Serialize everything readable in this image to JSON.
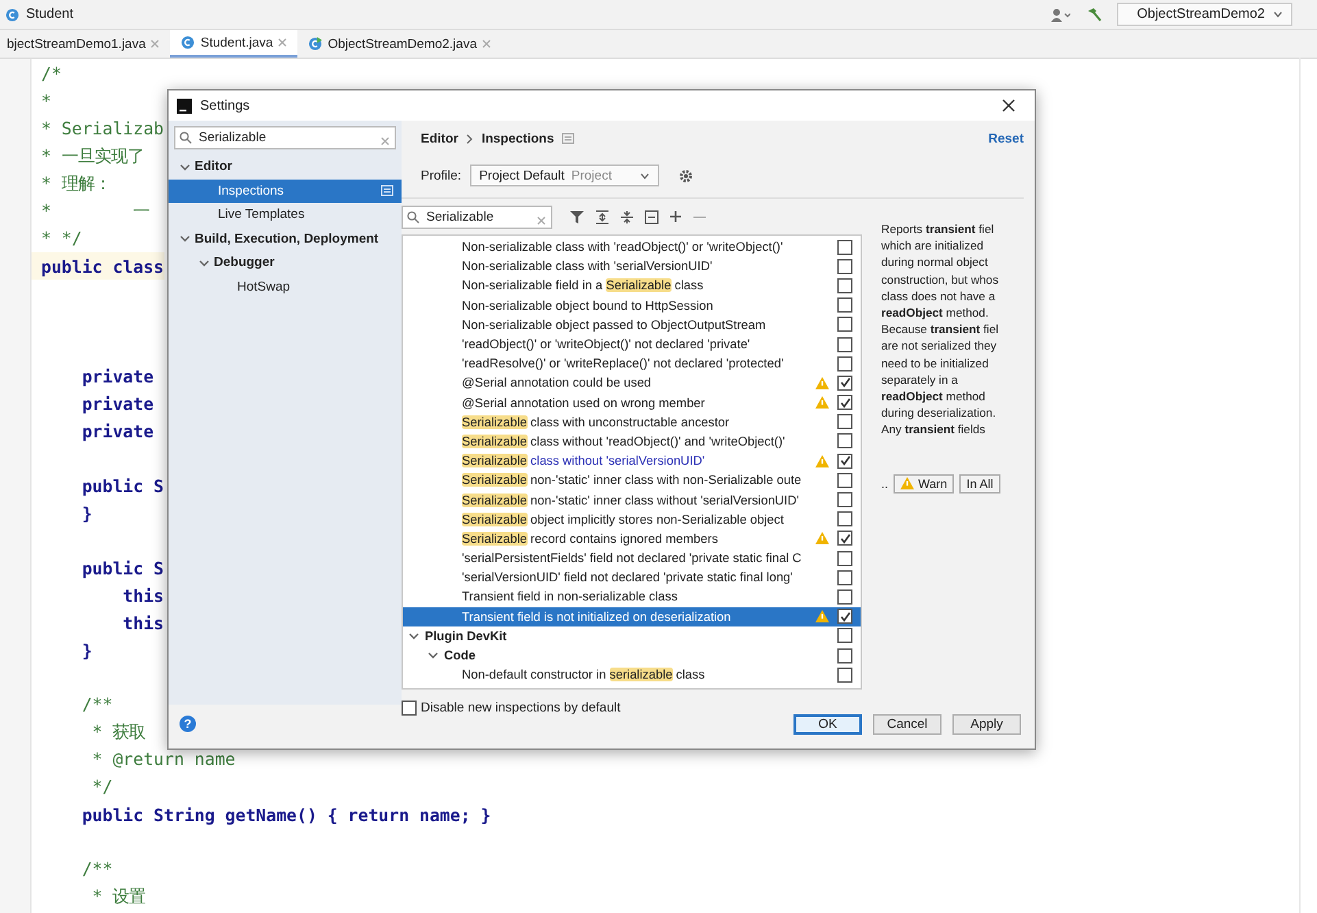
{
  "ide": {
    "title": "Student",
    "run_config": "ObjectStreamDemo2"
  },
  "tabs": [
    {
      "label": "bjectStreamDemo1.java",
      "selected": false
    },
    {
      "label": "Student.java",
      "selected": true,
      "kind": "class"
    },
    {
      "label": "ObjectStreamDemo2.java",
      "selected": false,
      "kind": "runnable"
    }
  ],
  "code_lines": [
    {
      "kind": "comment",
      "text": "/*",
      "current": false
    },
    {
      "kind": "comment",
      "text": "*",
      "current": false
    },
    {
      "kind": "comment",
      "text": "* Serializab",
      "current": false
    },
    {
      "kind": "comment",
      "text": "* 一旦实现了",
      "current": false
    },
    {
      "kind": "comment",
      "text": "* 理解：",
      "current": false
    },
    {
      "kind": "comment",
      "text": "*        一",
      "current": false
    },
    {
      "kind": "comment",
      "text": "* */",
      "current": false
    },
    {
      "kind": "code",
      "text": "public class",
      "current": true
    },
    {
      "kind": "blank",
      "current": false
    },
    {
      "kind": "blank",
      "current": false
    },
    {
      "kind": "blank",
      "current": false
    },
    {
      "kind": "code",
      "text": "    private",
      "current": false
    },
    {
      "kind": "code",
      "text": "    private",
      "current": false
    },
    {
      "kind": "code",
      "text": "    private",
      "current": false
    },
    {
      "kind": "blank",
      "current": false
    },
    {
      "kind": "code",
      "text": "    public S",
      "current": false
    },
    {
      "kind": "code",
      "text": "    }",
      "current": false
    },
    {
      "kind": "blank",
      "current": false
    },
    {
      "kind": "code",
      "text": "    public S",
      "current": false
    },
    {
      "kind": "code",
      "text": "        this",
      "current": false
    },
    {
      "kind": "code",
      "text": "        this",
      "current": false
    },
    {
      "kind": "code",
      "text": "    }",
      "current": false
    },
    {
      "kind": "blank",
      "current": false
    },
    {
      "kind": "comment",
      "text": "    /**",
      "current": false
    },
    {
      "kind": "comment",
      "text": "     * 获取",
      "current": false
    },
    {
      "kind": "comment",
      "text": "     * @return name",
      "current": false
    },
    {
      "kind": "comment",
      "text": "     */",
      "current": false
    },
    {
      "kind": "code",
      "text": "    public String getName() { return name; }",
      "current": false
    },
    {
      "kind": "blank",
      "current": false
    },
    {
      "kind": "comment",
      "text": "    /**",
      "current": false
    },
    {
      "kind": "comment",
      "text": "     * 设置",
      "current": false
    }
  ],
  "dialog": {
    "title": "Settings",
    "search": {
      "value": "Serializable"
    },
    "tree": [
      {
        "label": "Editor",
        "expanded": true,
        "selected": false,
        "children": [
          {
            "label": "Inspections",
            "selected": true
          },
          {
            "label": "Live Templates",
            "selected": false
          }
        ]
      },
      {
        "label": "Build, Execution, Deployment",
        "expanded": true,
        "selected": false,
        "children": [
          {
            "label": "Debugger",
            "expanded": true,
            "selected": false,
            "children": [
              {
                "label": "HotSwap",
                "selected": false
              }
            ]
          }
        ]
      }
    ],
    "breadcrumb": [
      "Editor",
      "Inspections"
    ],
    "reset": "Reset",
    "profile": {
      "label": "Profile:",
      "value": "Project Default",
      "scope": "Project"
    },
    "filter": {
      "value": "Serializable"
    },
    "inspections": [
      {
        "kind": "inspection",
        "text": "Non-serializable class with 'readObject()' or 'writeObject()'",
        "warning": false,
        "checked": false,
        "selected": false,
        "modified": false
      },
      {
        "kind": "inspection",
        "text": "Non-serializable class with 'serialVersionUID'",
        "warning": false,
        "checked": false,
        "selected": false,
        "modified": false
      },
      {
        "kind": "inspection",
        "text": "Non-serializable field in a **Serializable** class",
        "warning": false,
        "checked": false,
        "selected": false,
        "modified": false
      },
      {
        "kind": "inspection",
        "text": "Non-serializable object bound to HttpSession",
        "warning": false,
        "checked": false,
        "selected": false,
        "modified": false
      },
      {
        "kind": "inspection",
        "text": "Non-serializable object passed to ObjectOutputStream",
        "warning": false,
        "checked": false,
        "selected": false,
        "modified": false
      },
      {
        "kind": "inspection",
        "text": "'readObject()' or 'writeObject()' not declared 'private'",
        "warning": false,
        "checked": false,
        "selected": false,
        "modified": false
      },
      {
        "kind": "inspection",
        "text": "'readResolve()' or 'writeReplace()' not declared 'protected'",
        "warning": false,
        "checked": false,
        "selected": false,
        "modified": false
      },
      {
        "kind": "inspection",
        "text": "@Serial annotation could be used",
        "warning": true,
        "checked": true,
        "selected": false,
        "modified": false
      },
      {
        "kind": "inspection",
        "text": "@Serial annotation used on wrong member",
        "warning": true,
        "checked": true,
        "selected": false,
        "modified": false
      },
      {
        "kind": "inspection",
        "text": "**Serializable** class with unconstructable ancestor",
        "warning": false,
        "checked": false,
        "selected": false,
        "modified": false
      },
      {
        "kind": "inspection",
        "text": "**Serializable** class without 'readObject()' and 'writeObject()'",
        "warning": false,
        "checked": false,
        "selected": false,
        "modified": false
      },
      {
        "kind": "inspection",
        "text": "**Serializable** class without 'serialVersionUID'",
        "warning": true,
        "checked": true,
        "selected": false,
        "modified": true
      },
      {
        "kind": "inspection",
        "text": "**Serializable** non-'static' inner class with non-Serializable oute",
        "warning": false,
        "checked": false,
        "selected": false,
        "modified": false
      },
      {
        "kind": "inspection",
        "text": "**Serializable** non-'static' inner class without 'serialVersionUID'",
        "warning": false,
        "checked": false,
        "selected": false,
        "modified": false
      },
      {
        "kind": "inspection",
        "text": "**Serializable** object implicitly stores non-Serializable object",
        "warning": false,
        "checked": false,
        "selected": false,
        "modified": false
      },
      {
        "kind": "inspection",
        "text": "**Serializable** record contains ignored members",
        "warning": true,
        "checked": true,
        "selected": false,
        "modified": false
      },
      {
        "kind": "inspection",
        "text": "'serialPersistentFields' field not declared 'private static final C",
        "warning": false,
        "checked": false,
        "selected": false,
        "modified": false
      },
      {
        "kind": "inspection",
        "text": "'serialVersionUID' field not declared 'private static final long'",
        "warning": false,
        "checked": false,
        "selected": false,
        "modified": false
      },
      {
        "kind": "inspection",
        "text": "Transient field in non-serializable class",
        "warning": false,
        "checked": false,
        "selected": false,
        "modified": false
      },
      {
        "kind": "inspection",
        "text": "Transient field is not initialized on deserialization",
        "warning": true,
        "checked": true,
        "selected": true,
        "modified": false
      },
      {
        "kind": "group",
        "text": "Plugin DevKit",
        "expanded": true,
        "checked": false,
        "selected": false,
        "children": [
          {
            "kind": "group",
            "text": "Code",
            "expanded": true,
            "checked": false,
            "selected": false,
            "children": [
              {
                "kind": "inspection",
                "text": "Non-default constructor in **serializable** class",
                "warning": false,
                "checked": false,
                "selected": false,
                "modified": false
              }
            ]
          }
        ]
      }
    ],
    "description": [
      "Reports **transient** fiel",
      "which are initialized",
      "during normal object",
      "construction, but whos",
      "class does not have a",
      "**readObject** method.",
      "Because **transient** fiel",
      "are not serialized they",
      "need to be initialized",
      "separately in a",
      "**readObject** method",
      "during deserialization.",
      "Any **transient** fields"
    ],
    "severity": {
      "label": "..",
      "value": "Warn",
      "scope": "In All"
    },
    "disable_new": {
      "label": "Disable new inspections by default",
      "checked": false
    },
    "help": "?",
    "buttons": [
      {
        "label": "OK",
        "default": true
      },
      {
        "label": "Cancel",
        "default": false
      },
      {
        "label": "Apply",
        "default": false
      }
    ]
  }
}
